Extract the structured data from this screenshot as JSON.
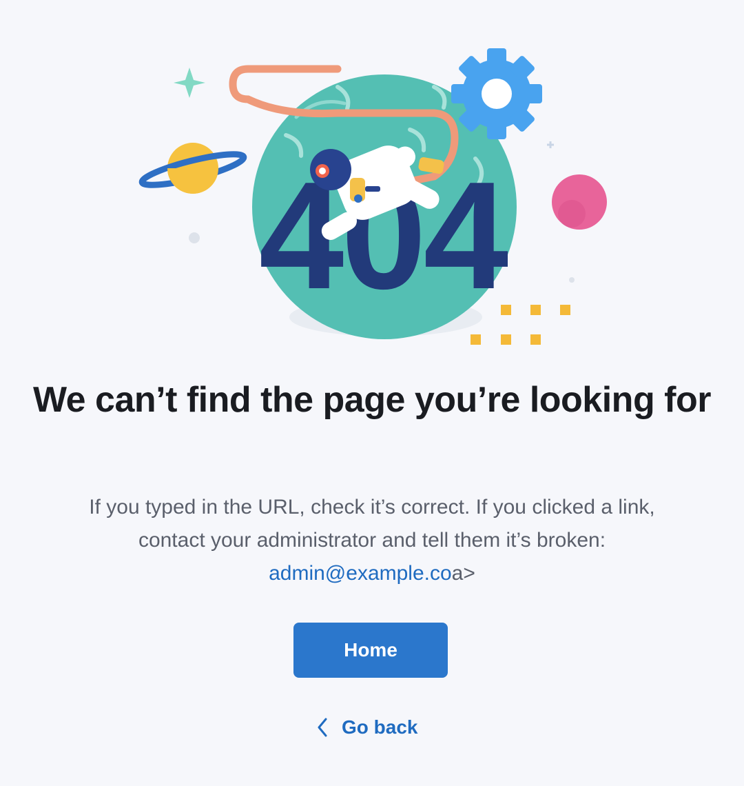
{
  "illustration": {
    "error_code": "404",
    "icons": [
      "planet-icon",
      "sparkle-icon",
      "gear-icon",
      "astronaut-icon",
      "moon-icon",
      "dots-icon"
    ]
  },
  "headline": "We can’t find the page you’re looking for",
  "message": {
    "line1": "If you typed in the URL, check it’s correct. If you clicked a link,",
    "line2": "contact your administrator and tell them it’s broken:",
    "email": "admin@example.co",
    "email_tail": "a>"
  },
  "actions": {
    "home_label": "Home",
    "back_label": "Go back",
    "back_icon": "chevron-left-icon"
  },
  "colors": {
    "background": "#f6f7fb",
    "primary_button": "#2b77cc",
    "link": "#1f6bc0",
    "headline": "#1a1c21",
    "body_text": "#5a5f6b"
  }
}
